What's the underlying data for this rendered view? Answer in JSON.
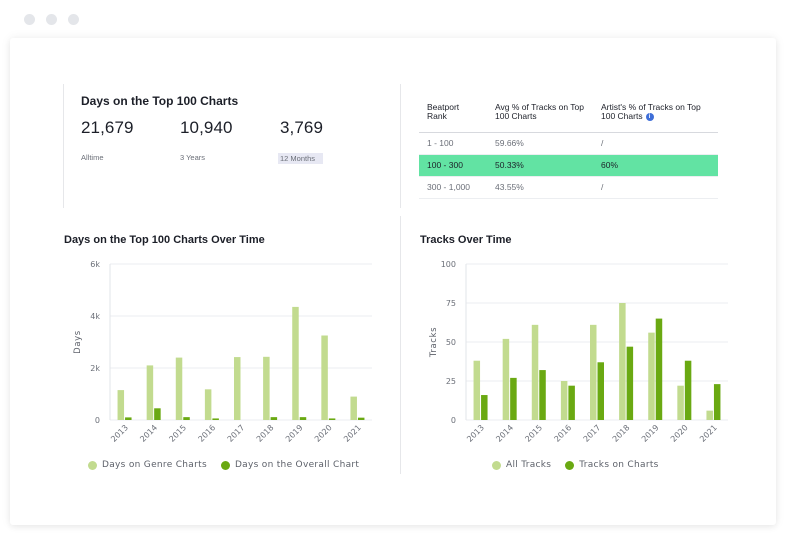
{
  "stats": {
    "title": "Days on the Top 100 Charts",
    "items": [
      {
        "value": "21,679",
        "label": "Alltime"
      },
      {
        "value": "10,940",
        "label": "3 Years"
      },
      {
        "value": "3,769",
        "label": "12 Months"
      }
    ]
  },
  "rank_table": {
    "headers": [
      "Beatport Rank",
      "Avg % of Tracks on Top 100 Charts",
      "Artist's % of Tracks on Top 100 Charts"
    ],
    "info_glyph": "i",
    "rows": [
      {
        "rank": "1 - 100",
        "avg": "59.66%",
        "artist": "/"
      },
      {
        "rank": "100 - 300",
        "avg": "50.33%",
        "artist": "60%"
      },
      {
        "rank": "300 - 1,000",
        "avg": "43.55%",
        "artist": "/"
      }
    ],
    "selected_row": 1,
    "highlight_color": "#62e3a3"
  },
  "colors": {
    "light_green": "#c2db8f",
    "dark_green": "#6aa912"
  },
  "chart_data": [
    {
      "type": "bar",
      "title": "Days on the Top 100 Charts Over Time",
      "ylabel": "Days",
      "xlabel": "",
      "categories": [
        "2013",
        "2014",
        "2015",
        "2016",
        "2017",
        "2018",
        "2019",
        "2020",
        "2021"
      ],
      "ylim": [
        0,
        6000
      ],
      "yticks": [
        0,
        2000,
        4000,
        6000
      ],
      "ytick_labels": [
        "0",
        "2k",
        "4k",
        "6k"
      ],
      "grid": true,
      "legend": "bottom",
      "series": [
        {
          "name": "Days on Genre Charts",
          "values": [
            1150,
            2100,
            2400,
            1180,
            2420,
            2430,
            4350,
            3250,
            900
          ]
        },
        {
          "name": "Days on the Overall Chart",
          "values": [
            100,
            450,
            110,
            60,
            0,
            110,
            110,
            60,
            90
          ]
        }
      ]
    },
    {
      "type": "bar",
      "title": "Tracks Over Time",
      "ylabel": "Tracks",
      "xlabel": "",
      "categories": [
        "2013",
        "2014",
        "2015",
        "2016",
        "2017",
        "2018",
        "2019",
        "2020",
        "2021"
      ],
      "ylim": [
        0,
        100
      ],
      "yticks": [
        0,
        25,
        50,
        75,
        100
      ],
      "ytick_labels": [
        "0",
        "25",
        "50",
        "75",
        "100"
      ],
      "grid": true,
      "legend": "bottom",
      "series": [
        {
          "name": "All Tracks",
          "values": [
            38,
            52,
            61,
            25,
            61,
            75,
            56,
            22,
            6
          ]
        },
        {
          "name": "Tracks on Charts",
          "values": [
            16,
            27,
            32,
            22,
            37,
            47,
            65,
            38,
            23
          ]
        }
      ]
    }
  ]
}
